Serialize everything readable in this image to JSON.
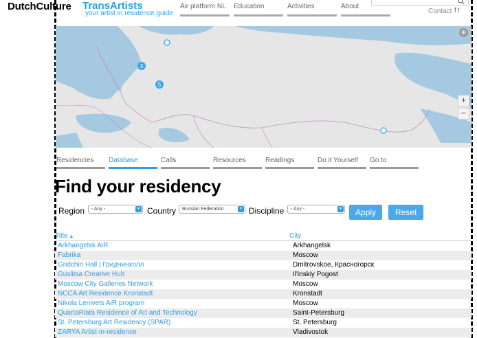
{
  "header": {
    "logo_part1": "DutchCulture",
    "logo_part2": "TransArtists",
    "tagline": "your artist in residence guide",
    "nav": [
      "Air platform NL",
      "Education",
      "Activities",
      "About"
    ],
    "contact": "Contact",
    "social_icons": [
      "facebook-icon",
      "twitter-icon"
    ]
  },
  "map": {
    "cluster_3": "3",
    "cluster_5": "5",
    "zoom_in": "+",
    "zoom_out": "−"
  },
  "subnav": {
    "items": [
      "Residencies",
      "Database",
      "Calls",
      "Resources",
      "Readings",
      "Do it Yourself",
      "Go to"
    ],
    "active": "Database"
  },
  "page_title": "Find your residency",
  "filters": {
    "region_label": "Region",
    "region_value": "- Any -",
    "country_label": "Country",
    "country_value": "Russian Federation",
    "discipline_label": "Discipline",
    "discipline_value": "- Any -",
    "apply": "Apply",
    "reset": "Reset"
  },
  "table": {
    "col_title": "Title",
    "col_city": "City",
    "rows": [
      {
        "title": "Arkhangelsk AiR",
        "city": "Arkhangelsk"
      },
      {
        "title": "Fabrika",
        "city": "Moscow"
      },
      {
        "title": "Gridchin Hall | Гридчинхолл",
        "city": "Dmitrovskoe, Красногорск"
      },
      {
        "title": "Guslitsa Creative Hub",
        "city": "Il'inskiy Pogost"
      },
      {
        "title": "Moscow City Galleries Network",
        "city": "Moscow"
      },
      {
        "title": "NCCA Art Residence Kronstadt",
        "city": "Kronstadt"
      },
      {
        "title": "Nikola Lenivets AiR program",
        "city": "Moscow"
      },
      {
        "title": "QuartaRiata Residence of Art and Technology",
        "city": "Saint-Petersburg"
      },
      {
        "title": "St. Petersburg Art Residency (SPAR)",
        "city": "St. Petersburg"
      },
      {
        "title": "ZARYA Artist-in-residence",
        "city": "Vladivostok"
      }
    ]
  }
}
